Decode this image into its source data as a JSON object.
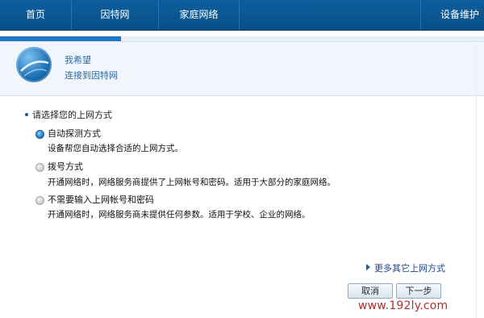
{
  "topnav": {
    "items": [
      {
        "label": "首页"
      },
      {
        "label": "因特网"
      },
      {
        "label": "家庭网络"
      },
      {
        "label": "设备维护"
      }
    ]
  },
  "progress": {
    "percent": 25
  },
  "banner": {
    "line1": "我希望",
    "line2": "连接到因特网",
    "icon": "globe-icon"
  },
  "question": {
    "label": "请选择您的上网方式"
  },
  "options": [
    {
      "title": "自动探测方式",
      "desc": "设备帮您自动选择合适的上网方式。",
      "selected": true
    },
    {
      "title": "拨号方式",
      "desc": "开通网络时，网络服务商提供了上网帐号和密码。适用于大部分的家庭网络。",
      "selected": false
    },
    {
      "title": "不需要输入上网帐号和密码",
      "desc": "开通网络时，网络服务商未提供任何参数。适用于学校、企业的网络。",
      "selected": false
    }
  ],
  "links": {
    "more": "更多其它上网方式"
  },
  "buttons": {
    "cancel": "取消",
    "next": "下一步"
  },
  "watermark": "www.192ly.com",
  "colors": {
    "nav_bg": "#0a4f86",
    "accent": "#1f78c6",
    "banner_text": "#2c6aa6",
    "watermark": "#b03030"
  }
}
